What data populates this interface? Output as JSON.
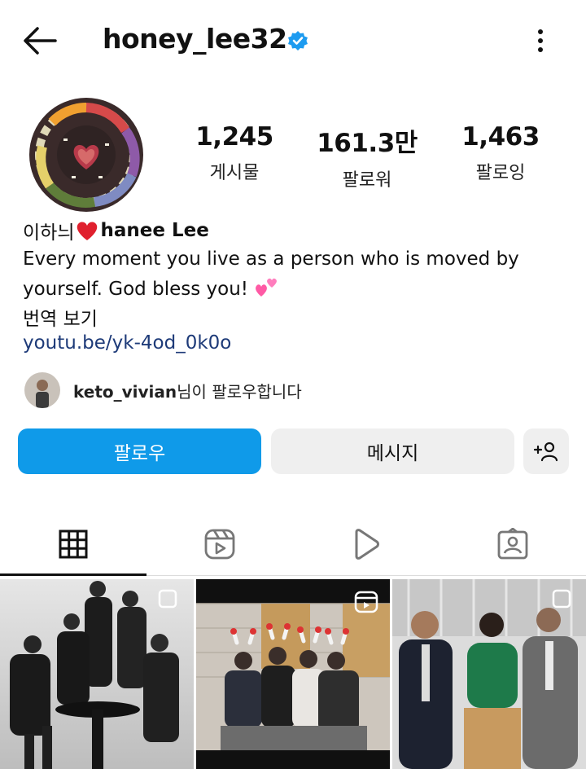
{
  "header": {
    "username": "honey_lee32",
    "verified": true,
    "back_icon": "arrow-left-icon",
    "more_icon": "vertical-dots-icon"
  },
  "profile": {
    "stats": [
      {
        "value": "1,245",
        "label": "게시물"
      },
      {
        "value": "161.3만",
        "label": "팔로워"
      },
      {
        "value": "1,463",
        "label": "팔로잉"
      }
    ],
    "name_korean": "이하늬",
    "name_english": "hanee Lee",
    "bio": "Every moment you live as a person who is moved by yourself. God bless you!",
    "translate_label": "번역 보기",
    "link": "youtu.be/yk-4od_0k0o"
  },
  "mutual": {
    "username": "keto_vivian",
    "suffix": "님이 팔로우합니다"
  },
  "actions": {
    "follow_label": "팔로우",
    "message_label": "메시지",
    "add_user_icon": "add-user-icon"
  },
  "tabs": [
    {
      "icon": "grid-icon",
      "active": true
    },
    {
      "icon": "reels-icon",
      "active": false
    },
    {
      "icon": "play-icon",
      "active": false
    },
    {
      "icon": "tagged-icon",
      "active": false
    }
  ],
  "colors": {
    "accent": "#0f9ae9",
    "verified": "#1d9bf0",
    "link": "#1d3a78"
  }
}
